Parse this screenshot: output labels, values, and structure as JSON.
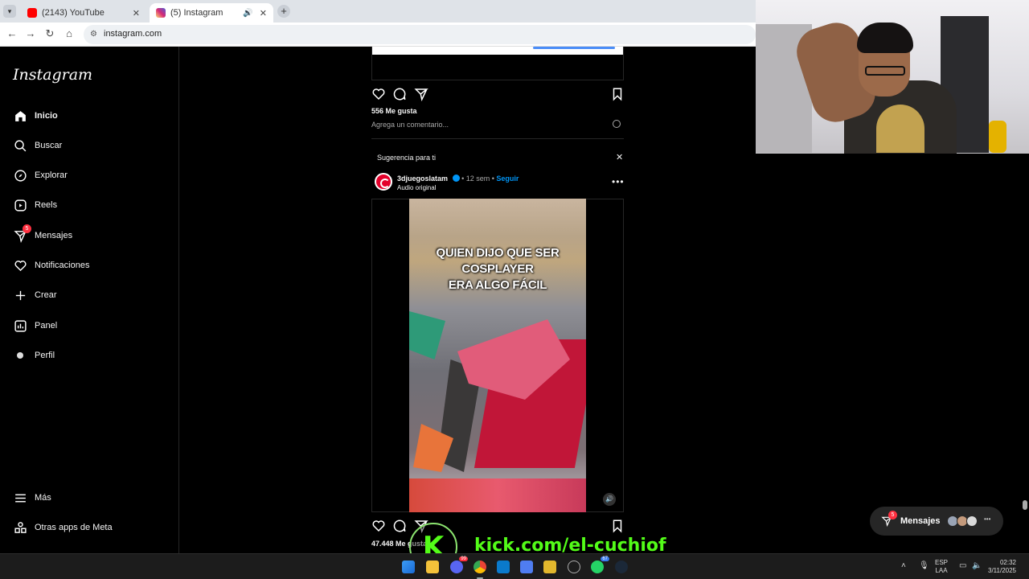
{
  "browser": {
    "tabs": [
      {
        "title": "(2143) YouTube",
        "active": false,
        "favicon_color": "#ff0000"
      },
      {
        "title": "(5) Instagram",
        "active": true,
        "favicon_color": "#d62976"
      }
    ],
    "url": "instagram.com"
  },
  "sidebar": {
    "logo": "Instagram",
    "items": [
      {
        "label": "Inicio",
        "icon": "home-icon"
      },
      {
        "label": "Buscar",
        "icon": "search-icon"
      },
      {
        "label": "Explorar",
        "icon": "compass-icon"
      },
      {
        "label": "Reels",
        "icon": "reels-icon"
      },
      {
        "label": "Mensajes",
        "icon": "messenger-icon",
        "badge": "5"
      },
      {
        "label": "Notificaciones",
        "icon": "heart-icon"
      },
      {
        "label": "Crear",
        "icon": "plus-icon"
      },
      {
        "label": "Panel",
        "icon": "chart-icon"
      },
      {
        "label": "Perfil",
        "icon": "avatar-icon"
      }
    ],
    "bottom": [
      {
        "label": "Más",
        "icon": "menu-icon"
      },
      {
        "label": "Otras apps de Meta",
        "icon": "meta-apps-icon"
      }
    ]
  },
  "feed": {
    "prev_post": {
      "likes": "556 Me gusta",
      "comment_placeholder": "Agrega un comentario..."
    },
    "suggestion": {
      "header": "Sugerencia para ti",
      "username": "3djuegoslatam",
      "time": "12 sem",
      "follow": "Seguir",
      "audio": "Audio original",
      "caption_line1": "QUIEN DIJO QUE SER COSPLAYER",
      "caption_line2": "ERA ALGO FÁCIL",
      "likes": "47.448 Me gusta"
    }
  },
  "messages_pill": {
    "label": "Mensajes",
    "badge": "5"
  },
  "overlay": {
    "kick_letter": "K",
    "kick_url": "kick.com/el-cuchiof"
  },
  "taskbar": {
    "lang_line1": "ESP",
    "lang_line2": "LAA",
    "time": "02:32",
    "date": "3/11/2025",
    "discord_badge": "99",
    "whatsapp_badge": "67"
  },
  "colors": {
    "accent": "#0095f6",
    "badge": "#ff3040",
    "kick": "#53fc18"
  }
}
